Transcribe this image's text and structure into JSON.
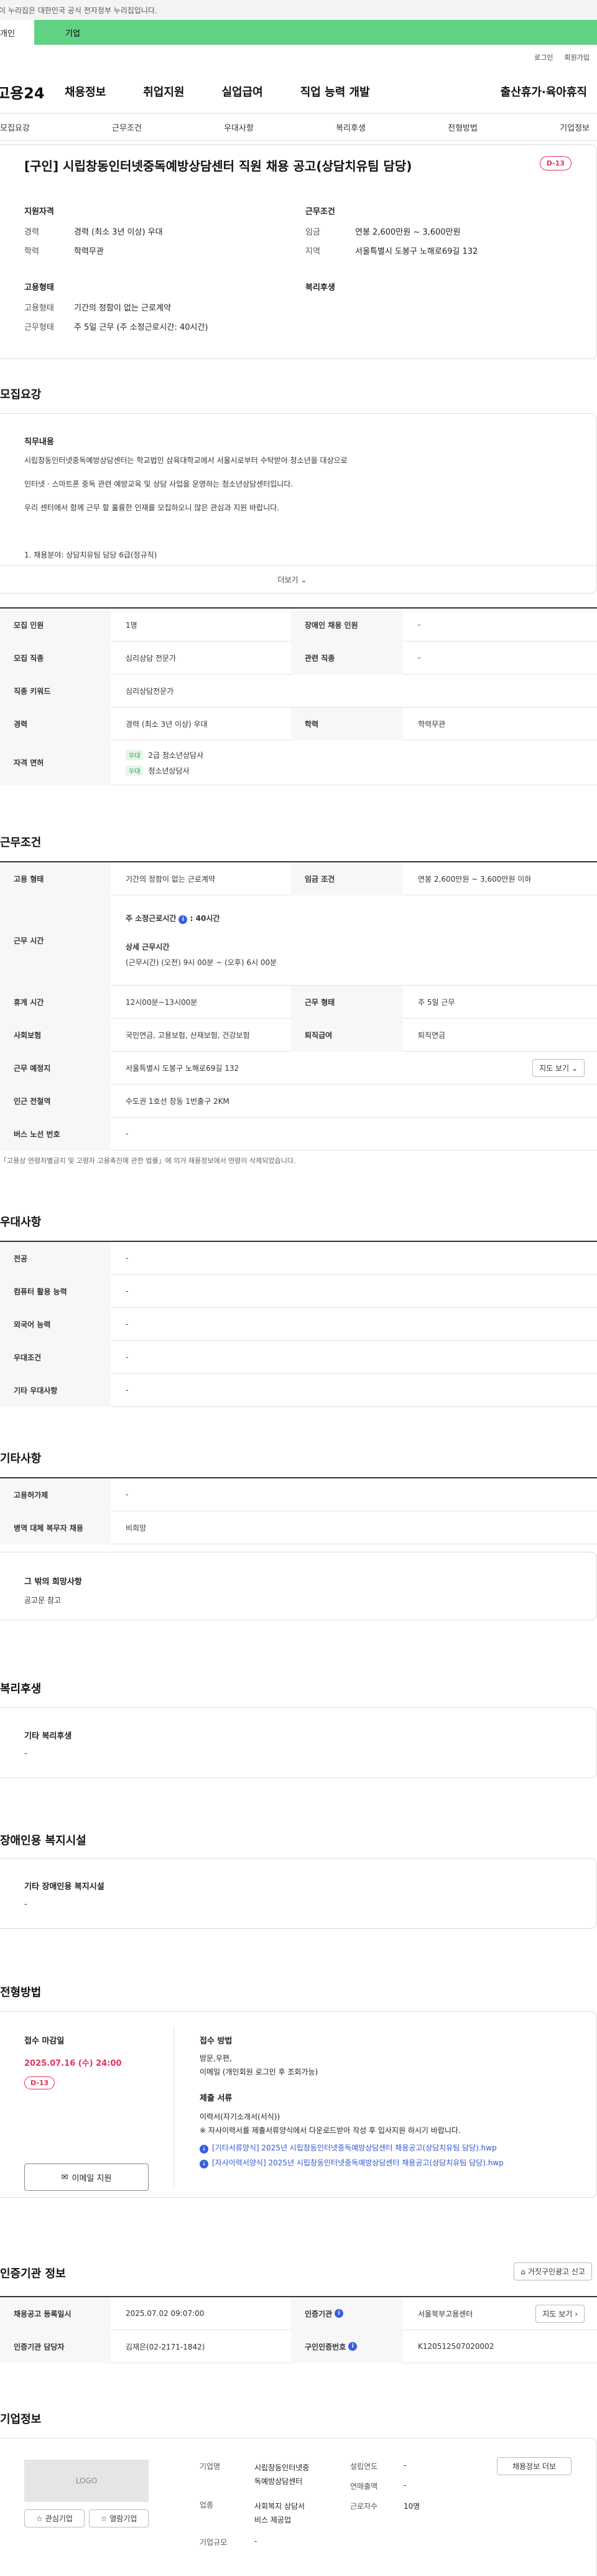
{
  "gov_banner": "이 누리집은 대한민국 공식 전자정부 누리집입니다.",
  "user_tabs": {
    "individual": "개인",
    "business": "기업"
  },
  "util": {
    "login": "로그인",
    "join": "회원가입"
  },
  "logo": "고용24",
  "gnb": [
    "채용정보",
    "취업지원",
    "실업급여",
    "직업 능력 개발",
    "출산휴가·육아휴직"
  ],
  "subnav": [
    "모집요강",
    "근무조건",
    "우대사항",
    "복리후생",
    "전형방법",
    "기업정보"
  ],
  "job": {
    "title": "[구인] 시립창동인터넷중독예방상담센터 직원 채용 공고(상담치유팀 담당)",
    "dday": "D-13",
    "qual_head": "지원자격",
    "career_k": "경력",
    "career_v": "경력 (최소 3년 이상) 우대",
    "edu_k": "학력",
    "edu_v": "학력무관",
    "emp_head": "고용형태",
    "emptype_k": "고용형태",
    "emptype_v": "기간의 정함이 없는 근로계약",
    "worktype_k": "근무형태",
    "worktype_v": "주 5일 근무 (주 소정근로시간: 40시간)",
    "cond_head": "근무조건",
    "wage_k": "임금",
    "wage_v": "연봉 2,600만원 ~ 3,600만원",
    "region_k": "지역",
    "region_v": "서울특별시 도봉구 노해로69길 132",
    "welfare_head": "복리후생"
  },
  "recruit": {
    "title": "모집요강",
    "duty_head": "직무내용",
    "duty_lines": [
      "시립창동인터넷중독예방상담센터는 학교법인 삼육대학교에서 서울시로부터 수탁받아 청소년을 대상으로",
      "인터넷 · 스마트폰 중독 관련 예방교육 및 상담 사업을 운영하는 청소년상담센터입니다.",
      "우리 센터에서 함께 근무 할 훌륭한 인재를 모집하오니 많은 관심과 지원 바랍니다.",
      "1. 채용분야: 상담치유팀 담당 6급(정규직)"
    ],
    "more": "더보기",
    "rows": {
      "count_k": "모집 인원",
      "count_v": "1명",
      "disabled_k": "장애인 채용 인원",
      "disabled_v": "-",
      "job_k": "모집 직종",
      "job_v": "심리상담 전문가",
      "related_k": "관련 직종",
      "related_v": "-",
      "keyword_k": "직종 키워드",
      "keyword_v": "심리상담전문가",
      "career_k": "경력",
      "career_v": "경력 (최소 3년 이상) 우대",
      "edu_k": "학력",
      "edu_v": "학력무관",
      "license_k": "자격 면허",
      "license_tag": "우대",
      "license_1": "2급 청소년상담사",
      "license_2": "청소년상담사"
    }
  },
  "work": {
    "title": "근무조건",
    "emp_k": "고용 형태",
    "emp_v": "기간의 정함이 없는 근로계약",
    "wage_k": "임금 조건",
    "wage_v": "연봉 2,600만원 ~ 3,600만원 이하",
    "hours_k": "근무 시간",
    "hours_main": "주 소정근로시간",
    "hours_num": "40시간",
    "hours_detail_head": "상세 근무시간",
    "hours_detail": "(근무시간) (오전) 9시 00분 ~ (오후) 6시 00분",
    "rest_k": "휴게 시간",
    "rest_v": "12시00분~13시00분",
    "form_k": "근무 형태",
    "form_v": "주 5일 근무",
    "ins_k": "사회보험",
    "ins_v": "국민연금, 고용보험, 산재보험, 건강보험",
    "retire_k": "퇴직급여",
    "retire_v": "퇴직연금",
    "place_k": "근무 예정지",
    "place_v": "서울특별시 도봉구 노해로69길 132",
    "map_btn": "지도 보기",
    "subway_k": "인근 전철역",
    "subway_v": "수도권 1호선 창동 1번출구 2KM",
    "bus_k": "버스 노선 번호",
    "bus_v": "-",
    "note": "「고용상 연령차별금지 및 고령자 고용촉진에 관한 법률」에 의거 채용정보에서 연령이 삭제되었습니다."
  },
  "pref": {
    "title": "우대사항",
    "rows": [
      {
        "k": "전공",
        "v": "-"
      },
      {
        "k": "컴퓨터 활용 능력",
        "v": "-"
      },
      {
        "k": "외국어 능력",
        "v": "-"
      },
      {
        "k": "우대조건",
        "v": "-"
      },
      {
        "k": "기타 우대사항",
        "v": "-"
      }
    ]
  },
  "etc": {
    "title": "기타사항",
    "rows": [
      {
        "k": "고용허가제",
        "v": "-"
      },
      {
        "k": "병역 대체 복무자 채용",
        "v": "비희망"
      }
    ],
    "other_head": "그 밖의 희망사항",
    "other_v": "공고문 참고"
  },
  "welfare": {
    "title": "복리후생",
    "head": "기타 복리후생",
    "v": "-"
  },
  "facility": {
    "title": "장애인용 복지시설",
    "head": "기타 장애인용 복지시설",
    "v": "-"
  },
  "process": {
    "title": "전형방법",
    "deadline_head": "접수 마감일",
    "deadline": "2025.07.16 (수) 24:00",
    "dday": "D-13",
    "email_btn": "이메일 지원",
    "method_head": "접수 방법",
    "method_1": "방문,우편,",
    "method_2": "이메일 (개인회원 로그인 후 조회가능)",
    "docs_head": "제출 서류",
    "docs_1": "이력서(자기소개서(서식))",
    "docs_2": "※ 자사이력서를 제출서류양식에서 다운로드받아 작성 후 입사지원 하시기 바랍니다.",
    "file_1": "[기타서류양식] 2025년 시립창동인터넷중독예방상담센터 채용공고(상담치유팀 담당).hwp",
    "file_2": "[자사이력서양식] 2025년 시립창동인터넷중독예방상담센터 채용공고(상담치유팀 담당).hwp"
  },
  "agency": {
    "title": "인증기관 정보",
    "report_btn": "거짓구인광고 신고",
    "reg_k": "채용공고 등록일시",
    "reg_v": "2025.07.02 09:07:00",
    "agency_k": "인증기관",
    "agency_v": "서울북부고용센터",
    "map_btn": "지도 보기",
    "mgr_k": "인증기관 담당자",
    "mgr_v": "김재은(02-2171-1842)",
    "no_k": "구인인증번호",
    "no_v": "K120512507020002"
  },
  "company": {
    "title": "기업정보",
    "logo": "LOGO",
    "fav_btn": "관심기업",
    "recent_btn": "열람기업",
    "name_k": "기업명",
    "name_v1": "시립창동인터넷중",
    "name_v2": "독예방상담센터",
    "found_k": "설립연도",
    "found_v": "-",
    "sales_k": "연매출액",
    "sales_v": "-",
    "biz_k": "업종",
    "biz_v1": "사회복지 상담서",
    "biz_v2": "비스 제공업",
    "emp_k": "근로자수",
    "emp_v": "10명",
    "size_k": "기업규모",
    "size_v": "-",
    "list_btn": "채용정보 더보"
  }
}
